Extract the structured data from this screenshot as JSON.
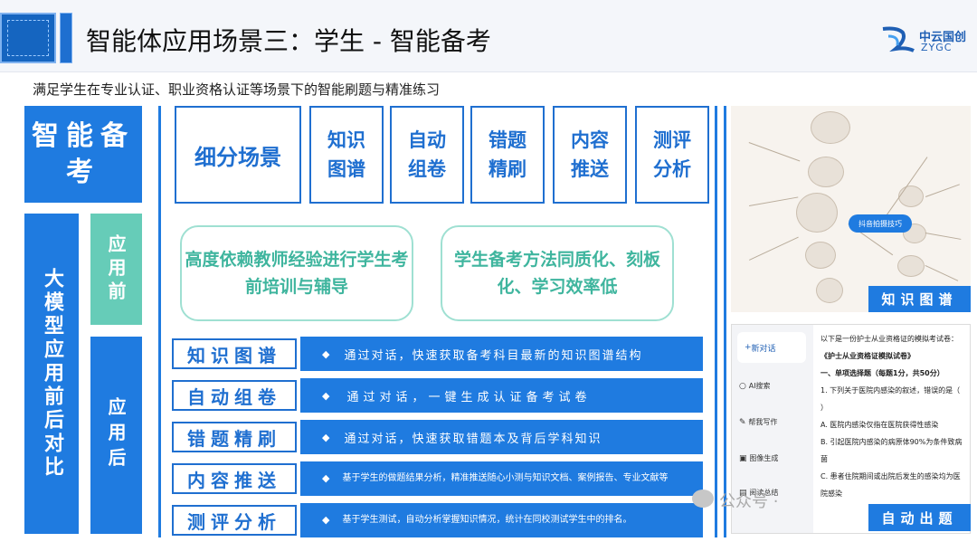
{
  "header": {
    "title": "智能体应用场景三：学生 - 智能备考",
    "logo_name": "中云国创",
    "logo_sub": "ZYGC",
    "brand_color": "#1f7be0"
  },
  "subtitle": "满足学生在专业认证、职业资格认证等场景下的智能刷题与精准练习",
  "left": {
    "big_title": "智能备考",
    "vertical_label": "大模型应用前后对比",
    "before_label": "应用前",
    "after_label": "应用后"
  },
  "features": {
    "main": "细分场景",
    "items": [
      "知识图谱",
      "自动组卷",
      "错题精刷",
      "内容推送",
      "测评分析"
    ]
  },
  "before": {
    "pill1": "高度依赖教师经验进行学生考前培训与辅导",
    "pill2": "学生备考方法同质化、刻板化、学习效率低"
  },
  "after_rows": [
    {
      "label": "知识图谱",
      "desc": "通过对话，快速获取备考科目最新的知识图谱结构"
    },
    {
      "label": "自动组卷",
      "desc": "通过对话，一键生成认证备考试卷"
    },
    {
      "label": "错题精刷",
      "desc": "通过对话，快速获取错题本及背后学科知识"
    },
    {
      "label": "内容推送",
      "desc": "基于学生的做题结果分析，精准推送随心小测与知识文档、案例报告、专业文献等"
    },
    {
      "label": "测评分析",
      "desc": "基于学生测试，自动分析掌握知识情况，统计在同校测试学生中的排名。"
    }
  ],
  "mindmap": {
    "center": "抖音拍摄技巧",
    "tag": "知识图谱"
  },
  "chat": {
    "new_chat": "新对话",
    "sidebar": [
      "AI搜索",
      "帮我写作",
      "图像生成",
      "阅读总结"
    ],
    "lines": [
      "以下是一份护士从业资格证的模拟考试卷：",
      "《护士从业资格证模拟试卷》",
      "一、单项选择题（每题1分，共50分）",
      "1. 下列关于医院内感染的叙述，错误的是（ ）",
      "A. 医院内感染仅指在医院获得性感染",
      "B. 引起医院内感染的病原体90%为条件致病菌",
      "C. 患者住院期间或出院后发生的感染均为医院感染"
    ],
    "tag": "自动出题"
  },
  "watermark": "公众号 ·"
}
